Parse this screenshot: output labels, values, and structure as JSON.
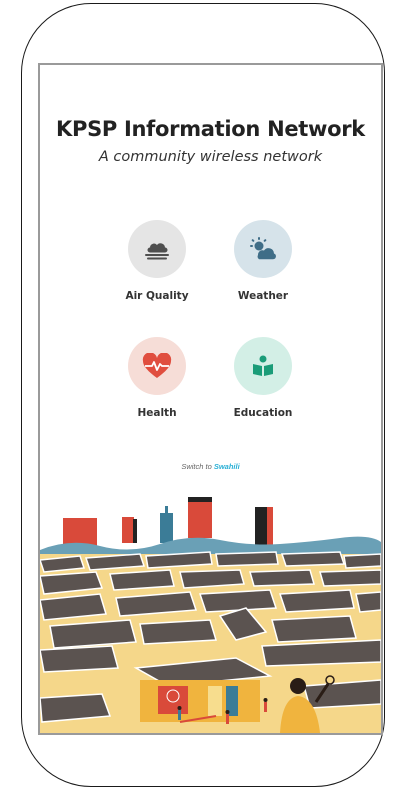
{
  "app": {
    "title": "KPSP Information Network",
    "subtitle": "A community wireless network"
  },
  "tiles": [
    {
      "label": "Air Quality",
      "icon": "air-quality-icon",
      "bg": "#e5e5e5",
      "fg": "#4f4f4f"
    },
    {
      "label": "Weather",
      "icon": "weather-icon",
      "bg": "#d6e3ea",
      "fg": "#3f6d87"
    },
    {
      "label": "Health",
      "icon": "heart-pulse-icon",
      "bg": "#f6ddd7",
      "fg": "#e04e3f"
    },
    {
      "label": "Education",
      "icon": "book-reader-icon",
      "bg": "#d3efe6",
      "fg": "#1a9c78"
    }
  ],
  "language": {
    "prefix": "Switch to",
    "link": "Swahili"
  }
}
